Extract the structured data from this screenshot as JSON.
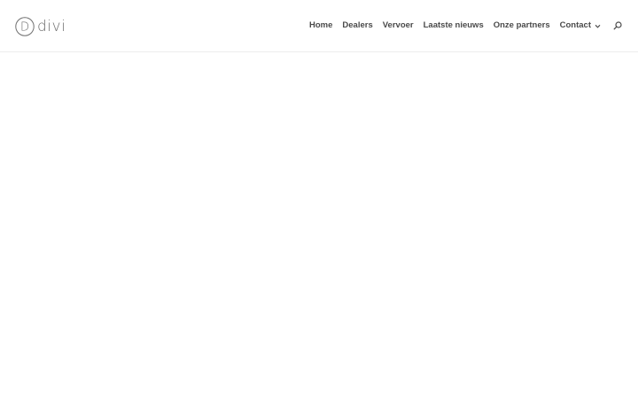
{
  "brand": {
    "logo_text": "divi",
    "logo_letter": "D"
  },
  "nav": {
    "items": [
      {
        "label": "Home"
      },
      {
        "label": "Dealers"
      },
      {
        "label": "Vervoer"
      },
      {
        "label": "Laatste nieuws"
      },
      {
        "label": "Onze partners"
      },
      {
        "label": "Contact",
        "has_submenu": true
      }
    ],
    "search_icon": "search-icon",
    "submenu_icon": "chevron-down-icon"
  },
  "colors": {
    "background": "#ffffff",
    "nav_text": "#4a4a4a",
    "logo": "#6f6f6f",
    "header_border": "#ececec"
  }
}
